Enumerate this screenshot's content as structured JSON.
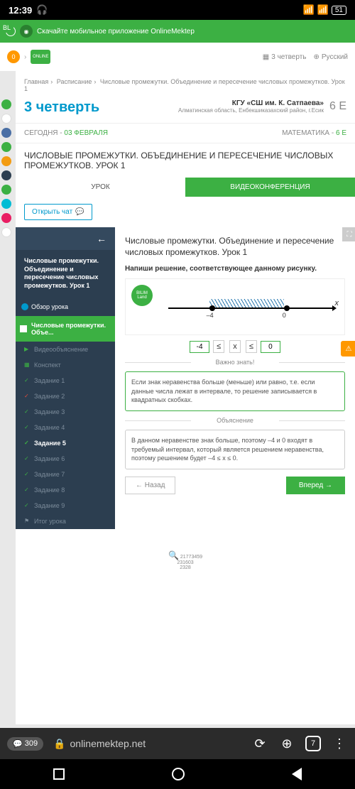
{
  "status": {
    "time": "12:39",
    "battery": "51"
  },
  "banner": {
    "text": "Скачайте мобильное приложение OnlineMektep"
  },
  "header": {
    "quarter_short": "3 четверть",
    "lang": "Русский",
    "user_initial": "0"
  },
  "breadcrumb": {
    "home": "Главная",
    "schedule": "Расписание",
    "lesson": "Числовые промежутки. Объединение и пересечение числовых промежутков. Урок 1"
  },
  "title": {
    "quarter": "3 четверть",
    "school": "КГУ «СШ им. К. Сатпаева»",
    "region": "Алматинская область, Енбекшиказахский район, г.Есик",
    "class": "6 E"
  },
  "date": {
    "today_lbl": "СЕГОДНЯ - ",
    "today": "03 ФЕВРАЛЯ",
    "subj_lbl": "МАТЕМАТИКА - ",
    "subj": "6 E"
  },
  "lesson_title": "ЧИСЛОВЫЕ ПРОМЕЖУТКИ. ОБЪЕДИНЕНИЕ И ПЕРЕСЕЧЕНИЕ ЧИСЛОВЫХ ПРОМЕЖУТКОВ. УРОК 1",
  "tabs": {
    "lesson": "УРОК",
    "video": "ВИДЕОКОНФЕРЕНЦИЯ"
  },
  "chat_btn": "Открыть чат",
  "sidebar": {
    "title": "Числовые промежутки. Объединение и пересечение числовых промежутков. Урок 1",
    "overview": "Обзор урока",
    "section": "Числовые промежутки. Объе...",
    "items": [
      "Видеообъяснение",
      "Конспект",
      "Задание 1",
      "Задание 2",
      "Задание 3",
      "Задание 4",
      "Задание 5",
      "Задание 6",
      "Задание 7",
      "Задание 8",
      "Задание 9",
      "Итог урока"
    ]
  },
  "main": {
    "title": "Числовые промежутки. Объединение и пересечение числовых промежутков. Урок 1",
    "instruction": "Напиши решение, соответствующее данному рисунку.",
    "fig_logo": "BILIM Land",
    "answer": {
      "left": "-4",
      "op1": "≤",
      "var": "x",
      "op2": "≤",
      "right": "0"
    },
    "know_title": "Важно знать!",
    "know_text": "Если знак неравенства больше (меньше) или равно, т.е. если данные числа лежат в интервале, то решение записывается в квадратных скобках.",
    "explain_title": "Объяснение",
    "explain_text": "В данном неравенстве знак больше, поэтому –4 и 0 входят в требуемый интервал, который является решением неравенства, поэтому решением будет –4 ≤ x ≤ 0.",
    "back_btn": "Назад",
    "fwd_btn": "Вперед"
  },
  "browser": {
    "comments": "309",
    "url": "onlinemektep.net",
    "tabs": "7"
  },
  "chart_data": {
    "type": "numberline",
    "points": [
      -4,
      0
    ],
    "closed": [
      true,
      true
    ],
    "shaded": [
      -4,
      0
    ],
    "labels": {
      "-4": "–4",
      "0": "0"
    },
    "axis_var": "x"
  }
}
